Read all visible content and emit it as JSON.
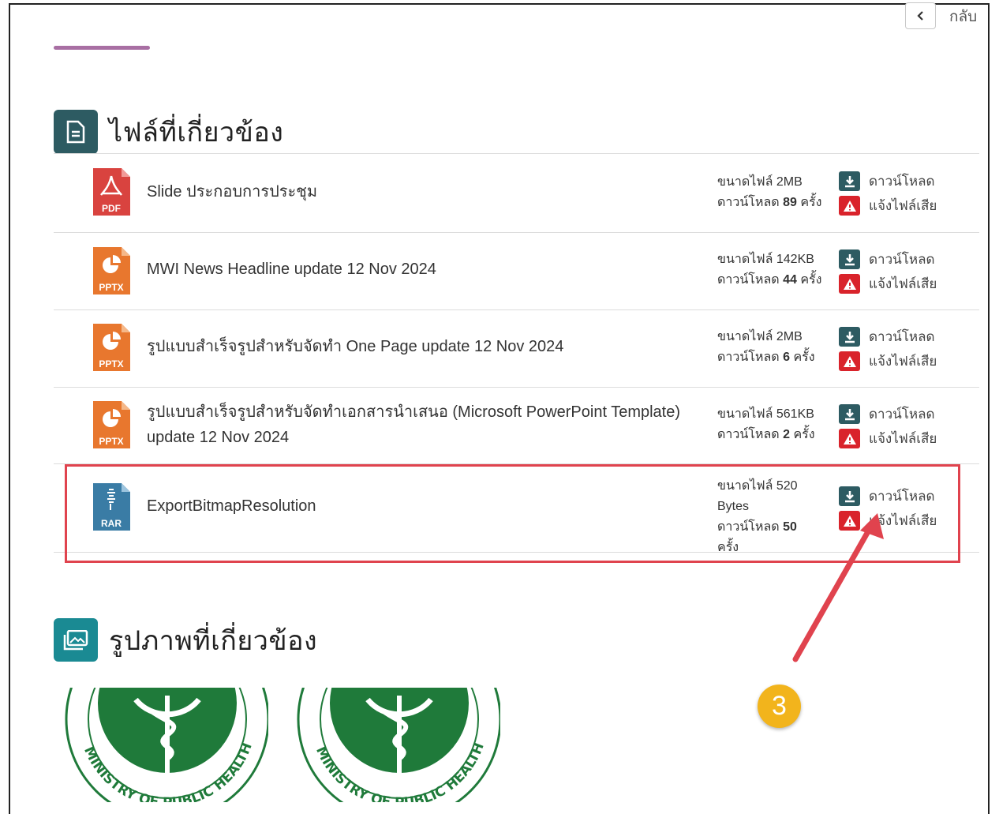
{
  "header": {
    "back_label": "กลับ"
  },
  "files_section": {
    "title": "ไฟล์ที่เกี่ยวข้อง",
    "rows": [
      {
        "type": "PDF",
        "name": "Slide ประกอบการประชุม",
        "size": "ขนาดไฟล์ 2MB",
        "downloads_prefix": "ดาวน์โหลด",
        "downloads_count": "89",
        "downloads_suffix": "ครั้ง",
        "download_label": "ดาวน์โหลด",
        "report_label": "แจ้งไฟล์เสีย"
      },
      {
        "type": "PPTX",
        "name": "MWI News Headline update 12 Nov 2024",
        "size": "ขนาดไฟล์ 142KB",
        "downloads_prefix": "ดาวน์โหลด",
        "downloads_count": "44",
        "downloads_suffix": "ครั้ง",
        "download_label": "ดาวน์โหลด",
        "report_label": "แจ้งไฟล์เสีย"
      },
      {
        "type": "PPTX",
        "name": "รูปแบบสำเร็จรูปสำหรับจัดทำ One Page update 12 Nov 2024",
        "size": "ขนาดไฟล์ 2MB",
        "downloads_prefix": "ดาวน์โหลด",
        "downloads_count": "6",
        "downloads_suffix": "ครั้ง",
        "download_label": "ดาวน์โหลด",
        "report_label": "แจ้งไฟล์เสีย"
      },
      {
        "type": "PPTX",
        "name": "รูปแบบสำเร็จรูปสำหรับจัดทำเอกสารนำเสนอ (Microsoft PowerPoint Template) update 12 Nov 2024",
        "size": "ขนาดไฟล์ 561KB",
        "downloads_prefix": "ดาวน์โหลด",
        "downloads_count": "2",
        "downloads_suffix": "ครั้ง",
        "download_label": "ดาวน์โหลด",
        "report_label": "แจ้งไฟล์เสีย"
      },
      {
        "type": "RAR",
        "name": "ExportBitmapResolution",
        "size": "ขนาดไฟล์ 520 Bytes",
        "downloads_prefix": "ดาวน์โหลด",
        "downloads_count": "50",
        "downloads_suffix": "ครั้ง",
        "download_label": "ดาวน์โหลด",
        "report_label": "แจ้งไฟล์เสีย"
      }
    ]
  },
  "images_section": {
    "title": "รูปภาพที่เกี่ยวข้อง",
    "logo_text": "MINISTRY OF PUBLIC HEALTH"
  },
  "annotation": {
    "step_number": "3"
  },
  "colors": {
    "accent_line": "#a86fa3",
    "section_icon_files": "#2d5b62",
    "section_icon_images": "#1a8a93",
    "download_icon": "#2d5b62",
    "warn_icon": "#d9232b",
    "highlight": "#e0434e",
    "badge": "#f2b41c",
    "pdf": "#d9433f",
    "pptx": "#e8772e",
    "rar": "#3a7ca5",
    "moph_green": "#1f7a3a"
  }
}
